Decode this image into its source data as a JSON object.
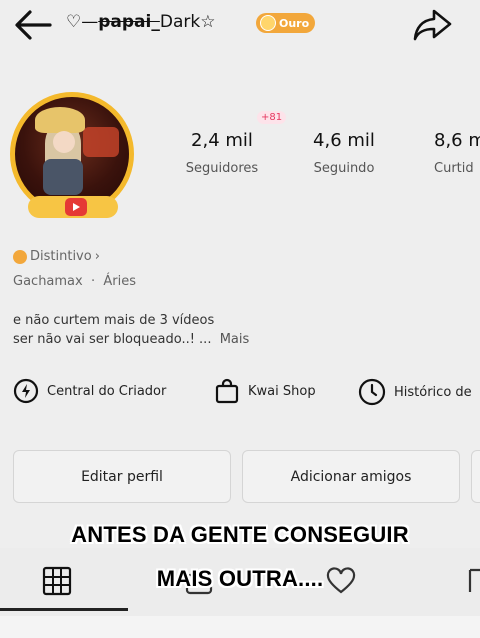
{
  "header": {
    "username": "papai_",
    "username_suffix": "Dark",
    "username_prefix_icon": "heart-outline-icon",
    "badge_label": "Ouro",
    "badge_color": "#f2a73b"
  },
  "profile": {
    "new_followers_badge": "+81",
    "stats": [
      {
        "value": "2,4 mil",
        "label": "Seguidores"
      },
      {
        "value": "4,6 mil",
        "label": "Seguindo"
      },
      {
        "value": "8,6 m",
        "label": "Curtid"
      }
    ],
    "distintivo_label": "Distintivo",
    "meta": "Gachamax  ·  Áries",
    "bio_line1": "e não curtem mais de 3 vídeos",
    "bio_line2": "ser não vai ser bloqueado..! ...",
    "bio_more": "Mais"
  },
  "creator_tools": [
    {
      "label": "Central do Criador",
      "icon": "lightning-circle-icon"
    },
    {
      "label": "Kwai Shop",
      "icon": "shopping-bag-icon"
    },
    {
      "label": "Histórico de",
      "icon": "clock-icon"
    }
  ],
  "actions": {
    "edit_label": "Editar perfil",
    "add_friends_label": "Adicionar amigos"
  },
  "overlay": {
    "line1": "ANTES DA GENTE CONSEGUIR",
    "line2": "MAIS OUTRA...."
  },
  "tabs": [
    "grid-icon",
    "lock-icon",
    "heart-icon",
    "bookmark-icon"
  ],
  "colors": {
    "background": "#eeeeee",
    "accent_gold": "#f4b92c",
    "badge_pink": "#e53961"
  }
}
